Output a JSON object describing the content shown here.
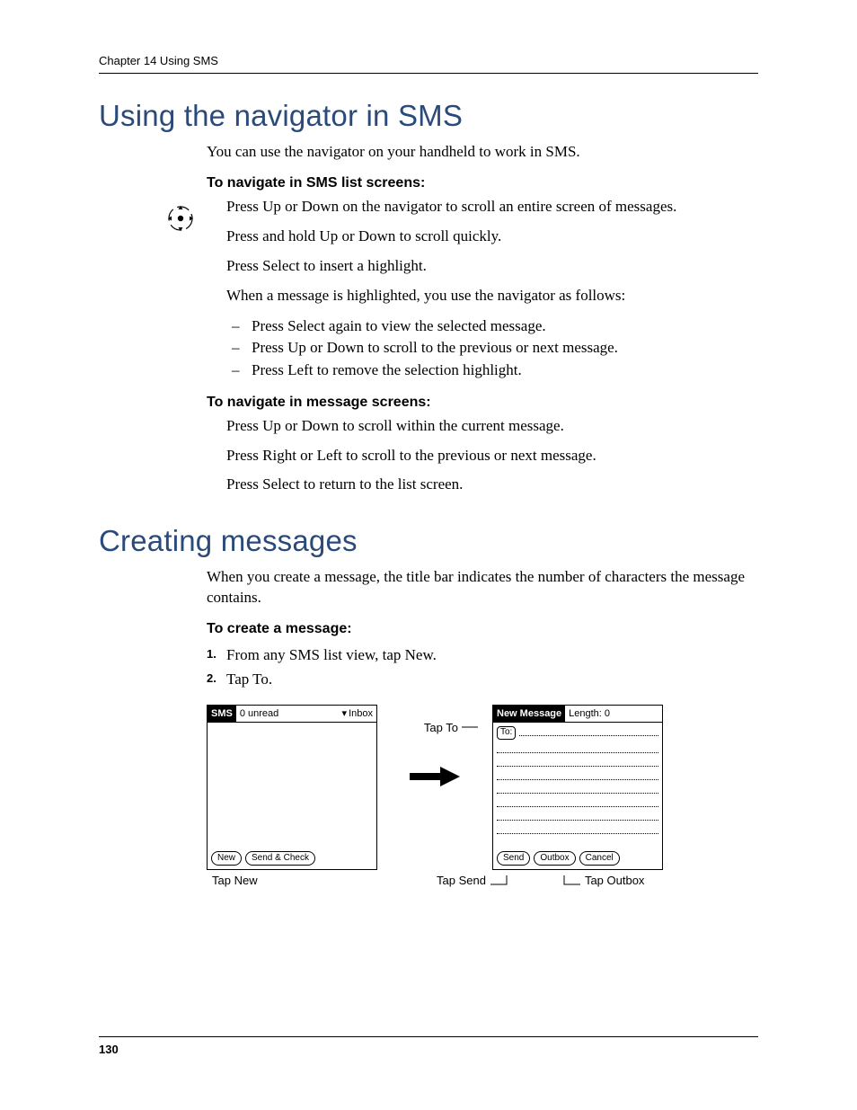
{
  "header": {
    "running": "Chapter 14   Using SMS"
  },
  "section1": {
    "title": "Using the navigator in SMS",
    "intro": "You can use the navigator on your handheld to work in SMS.",
    "sub1_title": "To navigate in SMS list screens:",
    "sub1_p1": "Press Up or Down on the navigator to scroll an entire screen of messages.",
    "sub1_p2": "Press and hold Up or Down to scroll quickly.",
    "sub1_p3": "Press Select to insert a highlight.",
    "sub1_p4": "When a message is highlighted, you use the navigator as follows:",
    "sub1_b1": "Press Select again to view the selected message.",
    "sub1_b2": "Press Up or Down to scroll to the previous or next message.",
    "sub1_b3": "Press Left to remove the selection highlight.",
    "sub2_title": "To navigate in message screens:",
    "sub2_p1": "Press Up or Down to scroll within the current message.",
    "sub2_p2": "Press Right or Left to scroll to the previous or next message.",
    "sub2_p3": "Press Select to return to the list screen."
  },
  "section2": {
    "title": "Creating messages",
    "intro": "When you create a message, the title bar indicates the number of characters the message contains.",
    "sub_title": "To create a message:",
    "step1": "From any SMS list view, tap New.",
    "step2": "Tap To."
  },
  "figure": {
    "pda1": {
      "app": "SMS",
      "status": "0 unread",
      "folder": "Inbox",
      "btn_new": "New",
      "btn_sendcheck": "Send & Check",
      "caption": "Tap New"
    },
    "tap_to": "Tap To",
    "pda2": {
      "app": "New Message",
      "length": "Length: 0",
      "to": "To:",
      "btn_send": "Send",
      "btn_outbox": "Outbox",
      "btn_cancel": "Cancel"
    },
    "caption_send": "Tap Send",
    "caption_outbox": "Tap Outbox"
  },
  "page_number": "130"
}
